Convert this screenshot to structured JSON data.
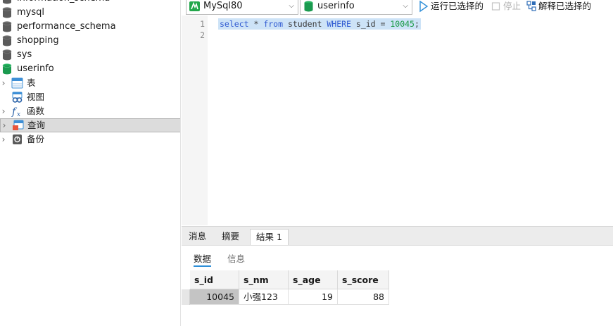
{
  "navigator": {
    "databases": [
      {
        "name": "information_schema"
      },
      {
        "name": "mysql"
      },
      {
        "name": "performance_schema"
      },
      {
        "name": "shopping"
      },
      {
        "name": "sys"
      },
      {
        "name": "userinfo"
      }
    ],
    "nodes": [
      {
        "label": "表",
        "icon": "table-icon"
      },
      {
        "label": "视图",
        "icon": "view-icon"
      },
      {
        "label": "函数",
        "icon": "function-icon"
      },
      {
        "label": "查询",
        "icon": "query-icon"
      },
      {
        "label": "备份",
        "icon": "backup-icon"
      }
    ],
    "selected_node": "查询",
    "colors": {
      "db_inactive": "#5b5b5b",
      "db_active": "#1a9a4f"
    }
  },
  "toolbar": {
    "connection": "MySql80",
    "database": "userinfo",
    "run_selected_label": "运行已选择的",
    "stop_label": "停止",
    "explain_label": "解释已选择的"
  },
  "editor": {
    "line_numbers": [
      "1",
      "2"
    ],
    "sql": {
      "select": "select",
      "star": " * ",
      "from": "from",
      "table": " student ",
      "where": "WHERE",
      "cond": " s_id = ",
      "value": "10045",
      "end": ";"
    }
  },
  "result_tabs": {
    "messages": "消息",
    "summary": "摘要",
    "result1": "结果 1"
  },
  "sub_tabs": {
    "data": "数据",
    "info": "信息"
  },
  "grid": {
    "columns": [
      "s_id",
      "s_nm",
      "s_age",
      "s_score"
    ],
    "rows": [
      [
        "10045",
        "小强123",
        "19",
        "88"
      ]
    ]
  }
}
